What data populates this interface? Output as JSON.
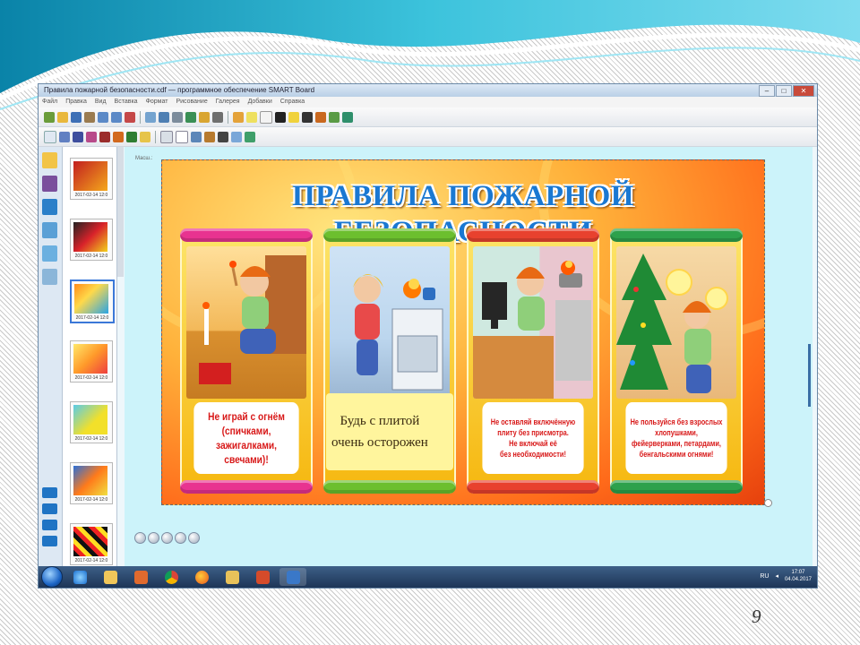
{
  "window": {
    "title": "Правила пожарной безопасности.cdf — программное обеспечение SMART Board",
    "controls": {
      "minimize": "–",
      "maximize": "□",
      "close": "✕"
    }
  },
  "menu": [
    "Файл",
    "Правка",
    "Вид",
    "Вставка",
    "Формат",
    "Рисование",
    "Галерея",
    "Добавки",
    "Справка"
  ],
  "toolbar1_tools": [
    "new-slide-icon",
    "open-icon",
    "save-icon",
    "paste-icon",
    "undo-icon",
    "redo-icon",
    "delete-icon",
    "screen-icon",
    "zoom-icon",
    "camera-icon",
    "table-icon",
    "gallery-icon",
    "document-camera-icon",
    "pen-icon",
    "highlighter-icon",
    "eraser-icon",
    "shapes-icon",
    "line-icon",
    "text-icon",
    "fill-icon",
    "properties-icon",
    "move-icon"
  ],
  "toolbar2_tools": [
    "select-icon",
    "pen-icon",
    "pen-icon",
    "pen-icon",
    "pen-icon",
    "pen-icon",
    "pen-icon",
    "eraser-icon",
    "line-icon",
    "shapes-icon",
    "fill-icon",
    "text-icon",
    "properties-icon"
  ],
  "sidepanel": {
    "zoom_label": "Масш.:",
    "tabs": [
      "page-sorter-icon",
      "gallery-icon",
      "attachments-icon",
      "properties-icon",
      "addons-icon",
      "lesson-activity-icon"
    ],
    "thumbnails": [
      {
        "label": "2017-02-14 12:0"
      },
      {
        "label": "2017-02-14 12:0"
      },
      {
        "label": "2017-02-14 12:0"
      },
      {
        "label": "2017-02-14 12:0"
      },
      {
        "label": "2017-02-14 12:0"
      },
      {
        "label": "2017-02-14 12:0"
      },
      {
        "label": "2017-02-14 12:0"
      }
    ]
  },
  "slide": {
    "title": "ПРАВИЛА ПОЖАРНОЙ БЕЗОПАСНОСТИ",
    "panels": [
      {
        "caption": "Не играй с огнём\n(спичками, зажигалками,\nсвечами)!",
        "color": "#e83390"
      },
      {
        "caption": "Будь с плитой\n     очень осторожен",
        "color": "#6cbf2e"
      },
      {
        "caption": "Не оставляй включённую\nплиту без присмотра.\nНе включай её\nбез необходимости!",
        "color": "#e8412e"
      },
      {
        "caption": "Не пользуйся без взрослых\nхлопушками,\nфейерверками, петардами,\nбенгальскими огнями!",
        "color": "#2da14c"
      }
    ]
  },
  "taskbar": {
    "apps": [
      "start-orb-icon",
      "internet-explorer-icon",
      "file-explorer-icon",
      "media-player-icon",
      "chrome-icon",
      "firefox-icon",
      "folder-icon",
      "presentation-icon",
      "smart-notebook-icon"
    ],
    "tray": {
      "lang": "RU",
      "time": "17:07",
      "date": "04.04.2017"
    }
  },
  "page_number": "9",
  "colors": {
    "accent": "#1a78d2",
    "caption_text": "#d81818",
    "workspace": "#ccf3fa",
    "taskbar": "#1d3557"
  }
}
